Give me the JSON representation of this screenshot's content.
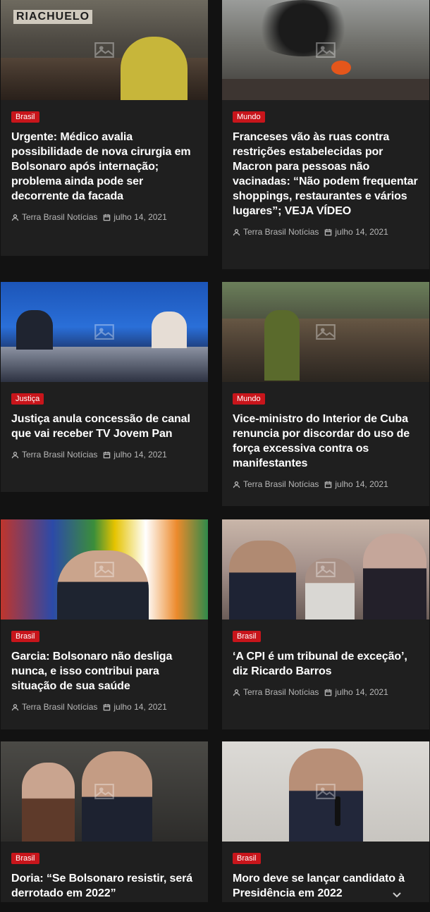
{
  "cards": [
    {
      "category": "Brasil",
      "title": "Urgente: Médico avalia possibilidade de nova cirurgia em Bolsonaro após internação; problema ainda pode ser decorrente da facada",
      "author": "Terra Brasil Notícias",
      "date": "julho 14, 2021",
      "image_text": "RIACHUELO"
    },
    {
      "category": "Mundo",
      "title": "Franceses vão às ruas contra restrições estabelecidas por Macron para pessoas não vacinadas: “Não podem frequentar shoppings, restaurantes e vários lugares”; VEJA VÍDEO",
      "author": "Terra Brasil Notícias",
      "date": "julho 14, 2021"
    },
    {
      "category": "Justiça",
      "title": "Justiça anula concessão de canal que vai receber TV Jovem Pan",
      "author": "Terra Brasil Notícias",
      "date": "julho 14, 2021"
    },
    {
      "category": "Mundo",
      "title": "Vice-ministro do Interior de Cuba renuncia por discordar do uso de força excessiva contra os manifestantes",
      "author": "Terra Brasil Notícias",
      "date": "julho 14, 2021"
    },
    {
      "category": "Brasil",
      "title": "Garcia: Bolsonaro não desliga nunca, e isso contribui para situação de sua saúde",
      "author": "Terra Brasil Notícias",
      "date": "julho 14, 2021"
    },
    {
      "category": "Brasil",
      "title": "‘A CPI é um tribunal de exceção’, diz Ricardo Barros",
      "author": "Terra Brasil Notícias",
      "date": "julho 14, 2021"
    },
    {
      "category": "Brasil",
      "title": "Doria: “Se Bolsonaro resistir, será derrotado em 2022”",
      "author": "",
      "date": ""
    },
    {
      "category": "Brasil",
      "title": "Moro deve se lançar candidato à Presidência em 2022",
      "author": "",
      "date": ""
    }
  ],
  "colors": {
    "badge": "#c8151b",
    "card_bg": "#1f1f1f",
    "page_bg": "#121212"
  },
  "icons": {
    "author": "user-icon",
    "date": "calendar-icon",
    "scroll": "chevron-down-icon"
  }
}
